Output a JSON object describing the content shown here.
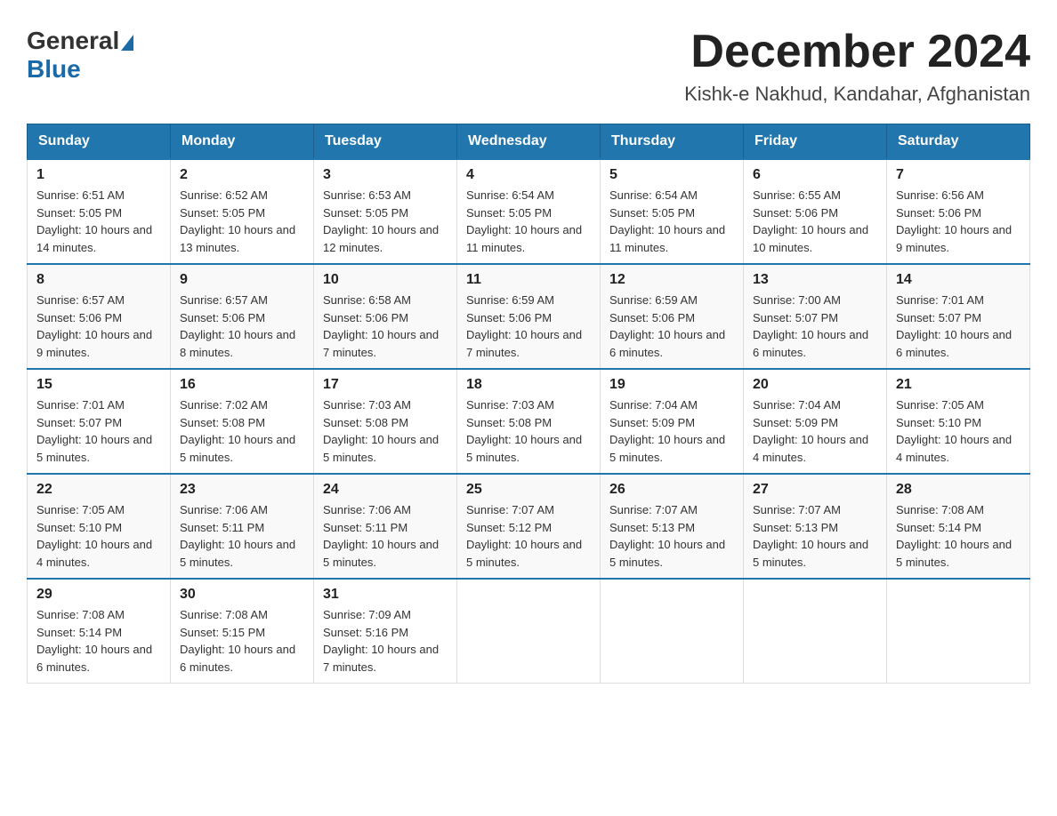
{
  "header": {
    "logo_general": "General",
    "logo_blue": "Blue",
    "main_title": "December 2024",
    "subtitle": "Kishk-e Nakhud, Kandahar, Afghanistan"
  },
  "weekdays": [
    "Sunday",
    "Monday",
    "Tuesday",
    "Wednesday",
    "Thursday",
    "Friday",
    "Saturday"
  ],
  "weeks": [
    [
      {
        "day": "1",
        "sunrise": "6:51 AM",
        "sunset": "5:05 PM",
        "daylight": "10 hours and 14 minutes."
      },
      {
        "day": "2",
        "sunrise": "6:52 AM",
        "sunset": "5:05 PM",
        "daylight": "10 hours and 13 minutes."
      },
      {
        "day": "3",
        "sunrise": "6:53 AM",
        "sunset": "5:05 PM",
        "daylight": "10 hours and 12 minutes."
      },
      {
        "day": "4",
        "sunrise": "6:54 AM",
        "sunset": "5:05 PM",
        "daylight": "10 hours and 11 minutes."
      },
      {
        "day": "5",
        "sunrise": "6:54 AM",
        "sunset": "5:05 PM",
        "daylight": "10 hours and 11 minutes."
      },
      {
        "day": "6",
        "sunrise": "6:55 AM",
        "sunset": "5:06 PM",
        "daylight": "10 hours and 10 minutes."
      },
      {
        "day": "7",
        "sunrise": "6:56 AM",
        "sunset": "5:06 PM",
        "daylight": "10 hours and 9 minutes."
      }
    ],
    [
      {
        "day": "8",
        "sunrise": "6:57 AM",
        "sunset": "5:06 PM",
        "daylight": "10 hours and 9 minutes."
      },
      {
        "day": "9",
        "sunrise": "6:57 AM",
        "sunset": "5:06 PM",
        "daylight": "10 hours and 8 minutes."
      },
      {
        "day": "10",
        "sunrise": "6:58 AM",
        "sunset": "5:06 PM",
        "daylight": "10 hours and 7 minutes."
      },
      {
        "day": "11",
        "sunrise": "6:59 AM",
        "sunset": "5:06 PM",
        "daylight": "10 hours and 7 minutes."
      },
      {
        "day": "12",
        "sunrise": "6:59 AM",
        "sunset": "5:06 PM",
        "daylight": "10 hours and 6 minutes."
      },
      {
        "day": "13",
        "sunrise": "7:00 AM",
        "sunset": "5:07 PM",
        "daylight": "10 hours and 6 minutes."
      },
      {
        "day": "14",
        "sunrise": "7:01 AM",
        "sunset": "5:07 PM",
        "daylight": "10 hours and 6 minutes."
      }
    ],
    [
      {
        "day": "15",
        "sunrise": "7:01 AM",
        "sunset": "5:07 PM",
        "daylight": "10 hours and 5 minutes."
      },
      {
        "day": "16",
        "sunrise": "7:02 AM",
        "sunset": "5:08 PM",
        "daylight": "10 hours and 5 minutes."
      },
      {
        "day": "17",
        "sunrise": "7:03 AM",
        "sunset": "5:08 PM",
        "daylight": "10 hours and 5 minutes."
      },
      {
        "day": "18",
        "sunrise": "7:03 AM",
        "sunset": "5:08 PM",
        "daylight": "10 hours and 5 minutes."
      },
      {
        "day": "19",
        "sunrise": "7:04 AM",
        "sunset": "5:09 PM",
        "daylight": "10 hours and 5 minutes."
      },
      {
        "day": "20",
        "sunrise": "7:04 AM",
        "sunset": "5:09 PM",
        "daylight": "10 hours and 4 minutes."
      },
      {
        "day": "21",
        "sunrise": "7:05 AM",
        "sunset": "5:10 PM",
        "daylight": "10 hours and 4 minutes."
      }
    ],
    [
      {
        "day": "22",
        "sunrise": "7:05 AM",
        "sunset": "5:10 PM",
        "daylight": "10 hours and 4 minutes."
      },
      {
        "day": "23",
        "sunrise": "7:06 AM",
        "sunset": "5:11 PM",
        "daylight": "10 hours and 5 minutes."
      },
      {
        "day": "24",
        "sunrise": "7:06 AM",
        "sunset": "5:11 PM",
        "daylight": "10 hours and 5 minutes."
      },
      {
        "day": "25",
        "sunrise": "7:07 AM",
        "sunset": "5:12 PM",
        "daylight": "10 hours and 5 minutes."
      },
      {
        "day": "26",
        "sunrise": "7:07 AM",
        "sunset": "5:13 PM",
        "daylight": "10 hours and 5 minutes."
      },
      {
        "day": "27",
        "sunrise": "7:07 AM",
        "sunset": "5:13 PM",
        "daylight": "10 hours and 5 minutes."
      },
      {
        "day": "28",
        "sunrise": "7:08 AM",
        "sunset": "5:14 PM",
        "daylight": "10 hours and 5 minutes."
      }
    ],
    [
      {
        "day": "29",
        "sunrise": "7:08 AM",
        "sunset": "5:14 PM",
        "daylight": "10 hours and 6 minutes."
      },
      {
        "day": "30",
        "sunrise": "7:08 AM",
        "sunset": "5:15 PM",
        "daylight": "10 hours and 6 minutes."
      },
      {
        "day": "31",
        "sunrise": "7:09 AM",
        "sunset": "5:16 PM",
        "daylight": "10 hours and 7 minutes."
      },
      null,
      null,
      null,
      null
    ]
  ]
}
